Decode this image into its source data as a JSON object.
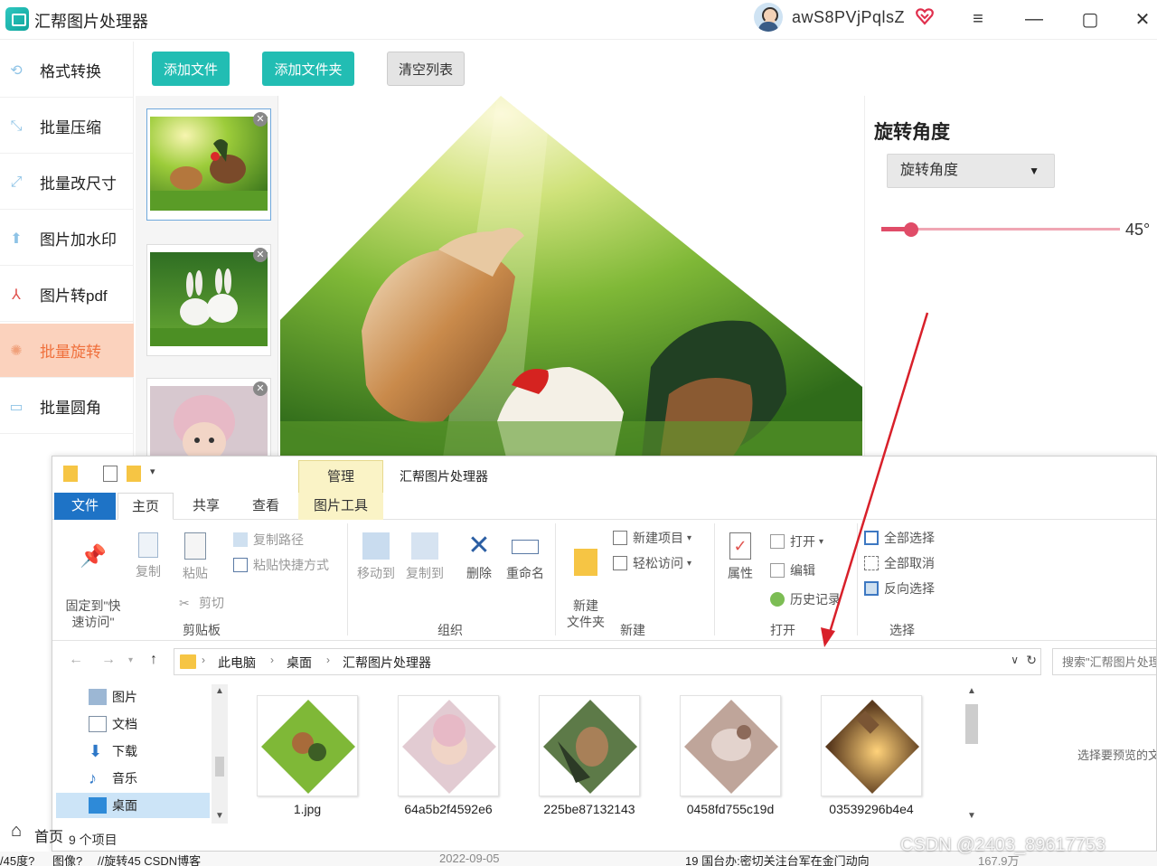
{
  "app": {
    "title": "汇帮图片处理器",
    "username": "awS8PVjPqlsZ",
    "window_controls": [
      "≡",
      "—",
      "▢",
      "✕"
    ],
    "accent_color": "#22bdb3",
    "active_color": "#f0713d"
  },
  "sidebar": {
    "items": [
      {
        "label": "格式转换",
        "icon": "format-convert-icon"
      },
      {
        "label": "批量压缩",
        "icon": "compress-icon"
      },
      {
        "label": "批量改尺寸",
        "icon": "resize-icon"
      },
      {
        "label": "图片加水印",
        "icon": "watermark-icon"
      },
      {
        "label": "图片转pdf",
        "icon": "pdf-icon"
      },
      {
        "label": "批量旋转",
        "icon": "rotate-icon",
        "active": true
      },
      {
        "label": "批量圆角",
        "icon": "round-corner-icon"
      }
    ]
  },
  "toolbar": {
    "add_file": "添加文件",
    "add_folder": "添加文件夹",
    "clear_list": "清空列表"
  },
  "thumbnails": [
    {
      "subject": "chickens",
      "selected": true
    },
    {
      "subject": "rabbits",
      "selected": false
    },
    {
      "subject": "baby",
      "selected": false
    }
  ],
  "rotate_panel": {
    "title": "旋转角度",
    "select_value": "旋转角度",
    "angle_value": "45°",
    "angle_fraction": 0.125
  },
  "explorer": {
    "context_tab": "管理",
    "title": "汇帮图片处理器",
    "tabs": {
      "file": "文件",
      "home": "主页",
      "share": "共享",
      "view": "查看",
      "picture_tools": "图片工具"
    },
    "ribbon": {
      "pin_quick_access": "固定到\"快\n速访问\"",
      "copy": "复制",
      "paste": "粘贴",
      "copy_path": "复制路径",
      "paste_shortcut": "粘贴快捷方式",
      "cut": "剪切",
      "clipboard_group": "剪贴板",
      "move_to": "移动到",
      "copy_to": "复制到",
      "delete": "删除",
      "rename": "重命名",
      "organize_group": "组织",
      "new_folder": "新建\n文件夹",
      "new_item": "新建项目",
      "easy_access": "轻松访问",
      "new_group": "新建",
      "properties": "属性",
      "open": "打开",
      "edit": "编辑",
      "history": "历史记录",
      "open_group": "打开",
      "select_all": "全部选择",
      "select_none": "全部取消",
      "invert_selection": "反向选择",
      "select_group": "选择"
    },
    "breadcrumb": [
      "此电脑",
      "桌面",
      "汇帮图片处理器"
    ],
    "search_placeholder": "搜索\"汇帮图片处理器\"",
    "nav_items": [
      {
        "label": "图片",
        "icon": "pictures-folder-icon"
      },
      {
        "label": "文档",
        "icon": "documents-folder-icon"
      },
      {
        "label": "下载",
        "icon": "downloads-folder-icon"
      },
      {
        "label": "音乐",
        "icon": "music-folder-icon"
      },
      {
        "label": "桌面",
        "icon": "desktop-folder-icon",
        "selected": true
      }
    ],
    "files": [
      {
        "name": "1.jpg"
      },
      {
        "name": "64a5b2f4592e6"
      },
      {
        "name": "225be87132143"
      },
      {
        "name": "0458fd755c19d"
      },
      {
        "name": "03539296b4e4"
      }
    ],
    "preview_hint": "选择要预览的文件。",
    "item_count": "9 个项目"
  },
  "background": {
    "home_label": "首页",
    "fragments": [
      "/45度?",
      "图像?",
      "//旋转45 CSDN博客",
      "2022-09-05",
      "19 国台办:密切关注台军在金门动向",
      "167.9万"
    ]
  },
  "watermark": "CSDN @2403_89617753"
}
